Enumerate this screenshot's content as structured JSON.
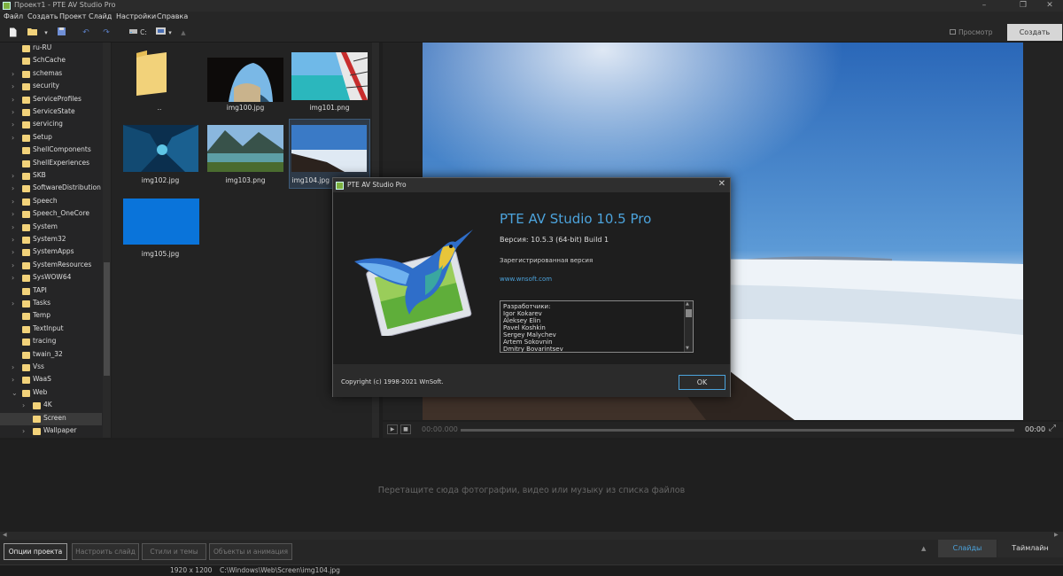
{
  "window": {
    "title": "Проект1 - PTE AV Studio Pro"
  },
  "menu": [
    "Файл",
    "Создать",
    "Проект",
    "Слайд",
    "Настройки",
    "Справка"
  ],
  "toolbar": {
    "drive_label": "C:",
    "preview_label": "Просмотр",
    "create_label": "Создать"
  },
  "tree": [
    {
      "label": "ru-RU",
      "expander": false
    },
    {
      "label": "SchCache",
      "expander": false
    },
    {
      "label": "schemas",
      "expander": true
    },
    {
      "label": "security",
      "expander": true
    },
    {
      "label": "ServiceProfiles",
      "expander": true
    },
    {
      "label": "ServiceState",
      "expander": true
    },
    {
      "label": "servicing",
      "expander": true
    },
    {
      "label": "Setup",
      "expander": true
    },
    {
      "label": "ShellComponents",
      "expander": false
    },
    {
      "label": "ShellExperiences",
      "expander": false
    },
    {
      "label": "SKB",
      "expander": true
    },
    {
      "label": "SoftwareDistribution",
      "expander": true
    },
    {
      "label": "Speech",
      "expander": true
    },
    {
      "label": "Speech_OneCore",
      "expander": true
    },
    {
      "label": "System",
      "expander": true
    },
    {
      "label": "System32",
      "expander": true
    },
    {
      "label": "SystemApps",
      "expander": true
    },
    {
      "label": "SystemResources",
      "expander": true
    },
    {
      "label": "SysWOW64",
      "expander": true
    },
    {
      "label": "TAPI",
      "expander": false
    },
    {
      "label": "Tasks",
      "expander": true
    },
    {
      "label": "Temp",
      "expander": false
    },
    {
      "label": "TextInput",
      "expander": false
    },
    {
      "label": "tracing",
      "expander": false
    },
    {
      "label": "twain_32",
      "expander": false
    },
    {
      "label": "Vss",
      "expander": true
    },
    {
      "label": "WaaS",
      "expander": true
    },
    {
      "label": "Web",
      "expander": "open"
    },
    {
      "label": "4K",
      "expander": true,
      "indent": 1
    },
    {
      "label": "Screen",
      "expander": false,
      "indent": 1,
      "selected": true
    },
    {
      "label": "Wallpaper",
      "expander": true,
      "indent": 1
    }
  ],
  "files": [
    {
      "name": "..",
      "kind": "folder"
    },
    {
      "name": "img100.jpg",
      "kind": "image"
    },
    {
      "name": "img101.png",
      "kind": "image"
    },
    {
      "name": "img102.jpg",
      "kind": "image"
    },
    {
      "name": "img103.png",
      "kind": "image"
    },
    {
      "name": "img104.jpg",
      "kind": "image",
      "selected": true
    },
    {
      "name": "img105.jpg",
      "kind": "image"
    }
  ],
  "player": {
    "time_start": "00:00.000",
    "time_end": "00:00"
  },
  "timeline": {
    "hint": "Перетащите сюда фотографии, видео или музыку из списка файлов"
  },
  "bottom": {
    "project_options": "Опции проекта",
    "customize_slide": "Настроить слайд",
    "styles_themes": "Стили и темы",
    "objects_animation": "Объекты и анимация",
    "tab_slides": "Слайды",
    "tab_timeline": "Таймлайн"
  },
  "status": {
    "resolution": "1920 x 1200",
    "path": "C:\\Windows\\Web\\Screen\\img104.jpg"
  },
  "dialog": {
    "title": "PTE AV Studio Pro",
    "app_title": "PTE AV Studio 10.5 Pro",
    "version": "Версия: 10.5.3 (64-bit) Build 1",
    "registered": "Зарегистрированная версия",
    "website": "www.wnsoft.com",
    "developers": [
      "Разработчики:",
      "Igor Kokarev",
      "Aleksey Elin",
      "Pavel Koshkin",
      "Sergey Malychev",
      "Artem Sokovnin",
      "Dmitry Bovarintsev"
    ],
    "copyright": "Copyright (c) 1998-2021 WnSoft.",
    "ok_label": "OK"
  },
  "colors": {
    "accent": "#4ca3dc",
    "folder": "#f2d27a",
    "app_icon": "#7fb241",
    "create_button_bg": "#d6d6d6"
  }
}
